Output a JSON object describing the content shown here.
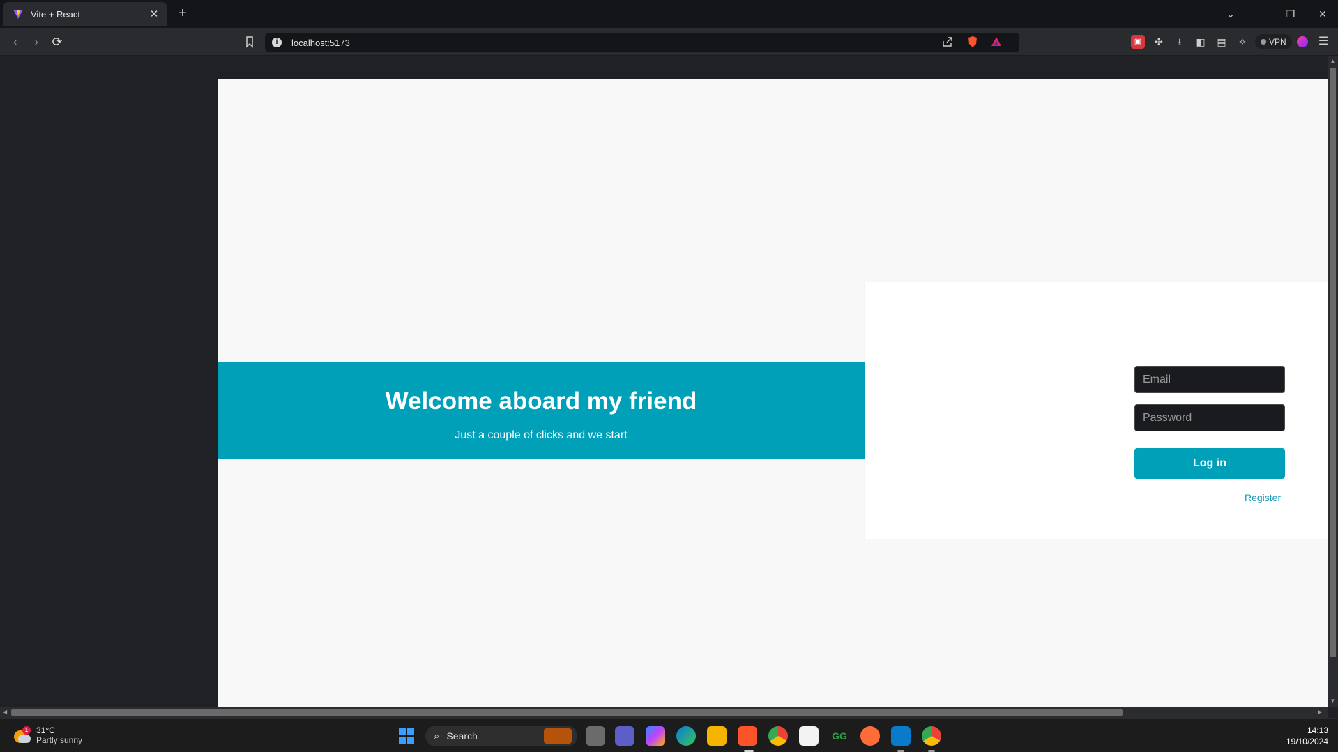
{
  "browser": {
    "tab_title": "Vite + React",
    "tab_close": "✕",
    "new_tab": "+",
    "url": "localhost:5173",
    "vpn_label": "VPN",
    "window_controls": [
      "⌄",
      "—",
      "❐",
      "✕"
    ]
  },
  "page": {
    "banner_title": "Welcome aboard my friend",
    "banner_subtitle": "Just a couple of clicks and we start",
    "email_placeholder": "Email",
    "password_placeholder": "Password",
    "login_label": "Log in",
    "register_label": "Register"
  },
  "taskbar": {
    "weather_temp": "31°C",
    "weather_condition": "Partly sunny",
    "weather_badge": "1",
    "search_label": "Search",
    "time": "14:13",
    "date": "19/10/2024"
  },
  "colors": {
    "accent": "#00a0b9",
    "page_bg": "#f8f8f8",
    "input_bg": "#1a1b1e"
  }
}
